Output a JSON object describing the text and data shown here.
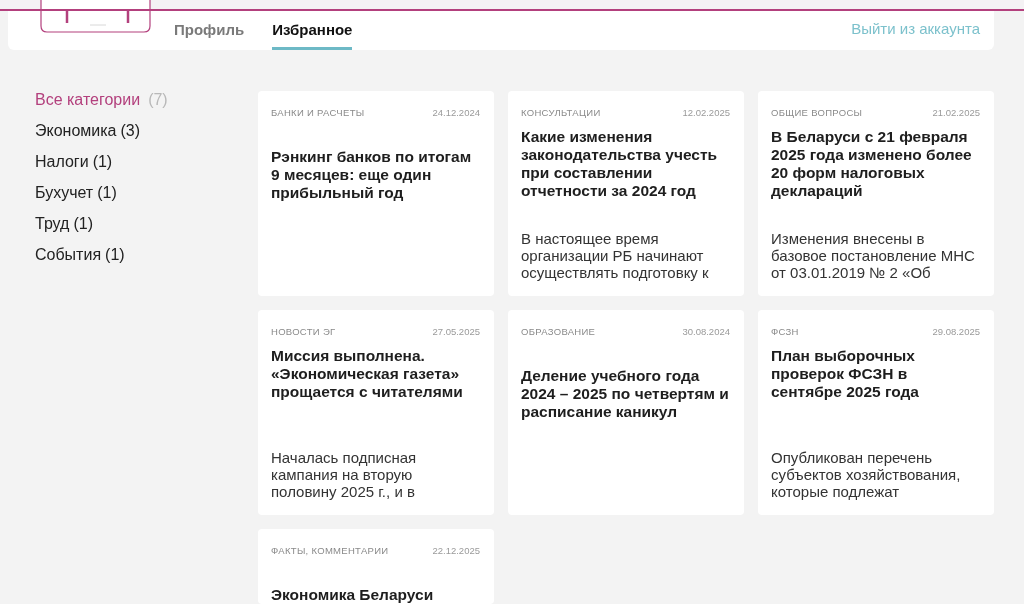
{
  "header": {
    "tabs": [
      {
        "label": "Профиль",
        "selected": false
      },
      {
        "label": "Избранное",
        "selected": true
      }
    ],
    "logout_link": "Выйти из аккаунта"
  },
  "sidebar": {
    "categories": [
      {
        "label": "Все категории",
        "count": "(7)",
        "selected": true
      },
      {
        "label": "Экономика",
        "count": "(3)",
        "selected": false
      },
      {
        "label": "Налоги",
        "count": "(1)",
        "selected": false
      },
      {
        "label": "Бухучет",
        "count": "(1)",
        "selected": false
      },
      {
        "label": "Труд",
        "count": "(1)",
        "selected": false
      },
      {
        "label": "События",
        "count": "(1)",
        "selected": false
      }
    ]
  },
  "articles": [
    {
      "category": "БАНКИ И РАСЧЕТЫ",
      "date": "24.12.2024",
      "title": "Рэнкинг банков по итогам 9 месяцев: еще один прибыльный год"
    },
    {
      "category": "КОНСУЛЬТАЦИИ",
      "date": "12.02.2025",
      "title": "Какие изменения законодательства учесть при составлении отчетности за 2024 год",
      "excerpt": "В настоящее время организации РБ начинают осуществлять подготовку к"
    },
    {
      "category": "ОБЩИЕ ВОПРОСЫ",
      "date": "21.02.2025",
      "title": "В Беларуси с 21 февраля 2025 года изменено более 20 форм налоговых деклараций",
      "excerpt": "Изменения внесены в базовое постановление МНС от 03.01.2019 № 2 «Об"
    },
    {
      "category": "НОВОСТИ ЭГ",
      "date": "27.05.2025",
      "title": "Миссия выполнена. «Экономическая газета» прощается с читателями",
      "excerpt": "Началась подписная кампания на вторую половину 2025 г., и в"
    },
    {
      "category": "ОБРАЗОВАНИЕ",
      "date": "30.08.2024",
      "title": "Деление учебного года 2024 – 2025 по четвертям и расписание каникул"
    },
    {
      "category": "ФСЗН",
      "date": "29.08.2025",
      "title": "План выборочных проверок ФСЗН в сентябре 2025 года",
      "excerpt": "Опубликован перечень субъектов хозяйствования, которые подлежат"
    },
    {
      "category": "ФАКТЫ, КОММЕНТАРИИ",
      "date": "22.12.2025",
      "title": "Экономика Беларуси"
    }
  ]
}
